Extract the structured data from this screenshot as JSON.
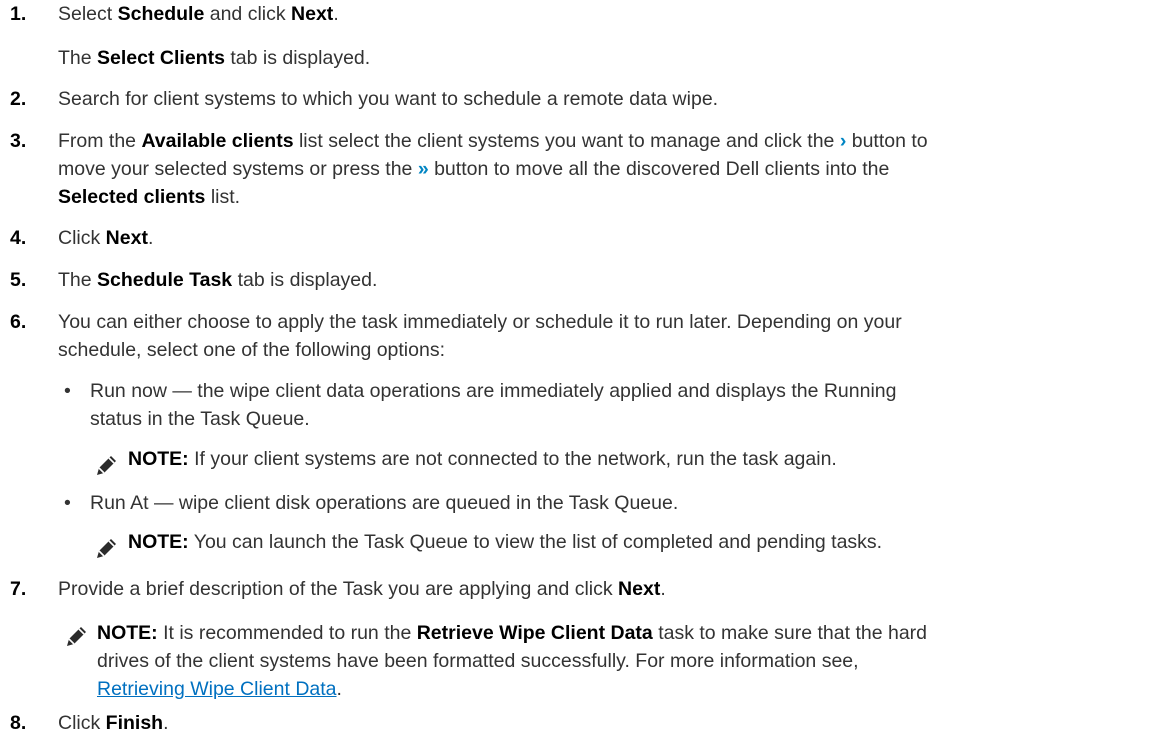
{
  "steps": [
    {
      "num": "1.",
      "pre": "Select ",
      "b1": "Schedule",
      "mid": " and click ",
      "b2": "Next",
      "post": "."
    },
    {
      "num": "2.",
      "text": "Search for client systems to which you want to schedule a remote data wipe."
    },
    {
      "num": "3.",
      "l1_pre": "From the ",
      "l1_bold": "Available clients",
      "l1_mid": " list select the client systems you want to manage and click the ",
      "l1_post": " button to",
      "l2_pre": "move your selected systems or press the ",
      "l2_post": " button to move all the discovered Dell clients into the",
      "l3_bold": "Selected clients",
      "l3_post": " list."
    },
    {
      "num": "4.",
      "pre": "Click ",
      "bold": "Next",
      "post": "."
    },
    {
      "num": "5.",
      "pre": "The ",
      "bold": "Schedule Task",
      "post": " tab is displayed."
    },
    {
      "num": "6.",
      "l1": "You can either choose to apply the task immediately or schedule it to run later. Depending on your",
      "l2": "schedule, select one of the following options:"
    },
    {
      "num": "7.",
      "pre": "Provide a brief description of the Task you are applying and click ",
      "bold": "Next",
      "post": "."
    },
    {
      "num": "8.",
      "pre": "Click ",
      "bold": "Finish",
      "post": "."
    }
  ],
  "step1_result": {
    "pre": "The ",
    "bold": "Select Clients",
    "post": " tab is displayed."
  },
  "icons": {
    "move_one": "chevron-right-icon",
    "move_all": "double-chevron-right-icon",
    "note": "pencil-note-icon"
  },
  "glyphs": {
    "move_one": "›",
    "move_all": "»"
  },
  "options": [
    {
      "bullet": "•",
      "l1": "Run now — the wipe client data operations are immediately applied and displays the Running",
      "l2": "status in the Task Queue."
    },
    {
      "bullet": "•",
      "l1": "Run At — wipe client disk operations are queued in the Task Queue."
    }
  ],
  "notes": [
    {
      "label": "NOTE:",
      "text": " If your client systems are not connected to the network, run the task again."
    },
    {
      "label": "NOTE:",
      "text": " You can launch the Task Queue to view the list of completed and pending tasks."
    },
    {
      "label": "NOTE:",
      "l1_pre": " It is recommended to run the ",
      "l1_bold": "Retrieve Wipe Client Data",
      "l1_post": " task to make sure that the hard",
      "l2": "drives of the client systems have been formatted successfully. For more information see,",
      "link": "Retrieving Wipe Client Data",
      "link_post": "."
    }
  ],
  "colors": {
    "link": "#0070c0",
    "accent": "#0085c3",
    "text": "#333333"
  }
}
